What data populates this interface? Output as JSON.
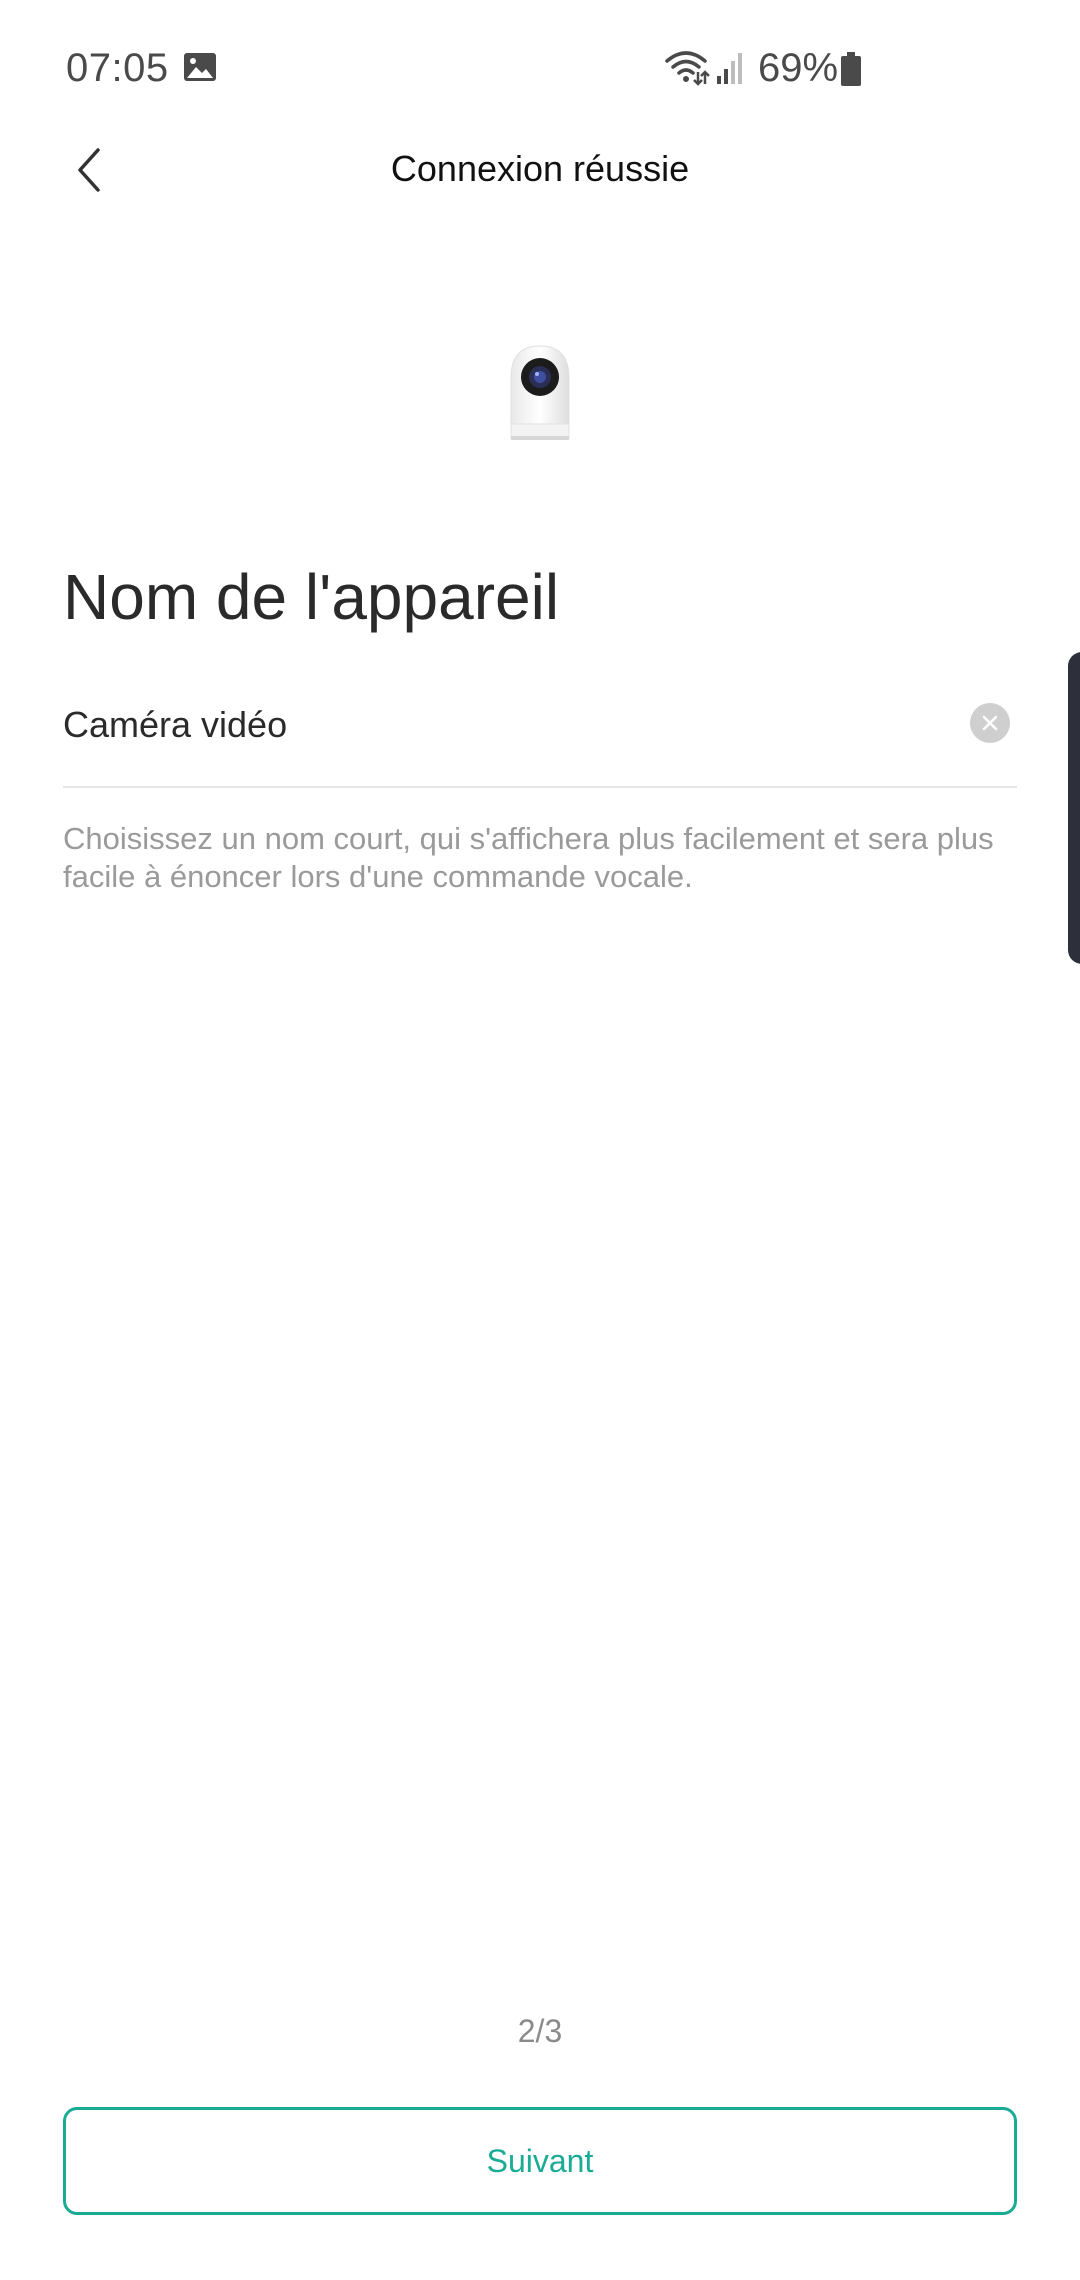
{
  "status_bar": {
    "time": "07:05",
    "battery_percent": "69%",
    "icons": [
      "gallery-icon",
      "wifi-icon",
      "signal-icon",
      "battery-icon"
    ]
  },
  "header": {
    "title": "Connexion réussie",
    "back_icon": "chevron-left-icon"
  },
  "device": {
    "image": "camera-device-icon"
  },
  "form": {
    "heading": "Nom de l'appareil",
    "name_value": "Caméra vidéo",
    "clear_icon": "clear-icon",
    "helper": "Choisissez un nom court, qui s'affichera plus facilement et sera plus facile à énoncer lors d'une commande vocale."
  },
  "footer": {
    "step": "2/3",
    "next_label": "Suivant"
  },
  "colors": {
    "accent": "#1aab95",
    "text_primary": "#2a2a2a",
    "text_secondary": "#9a9a9a",
    "divider": "#e6e6e6"
  }
}
